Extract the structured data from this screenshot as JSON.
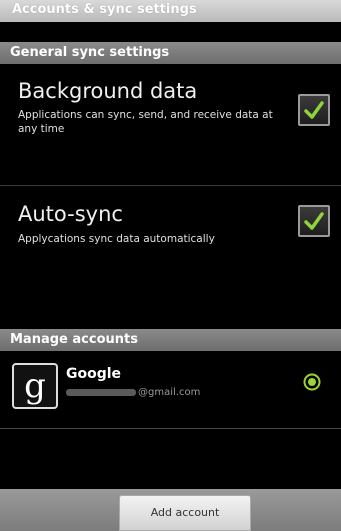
{
  "title_bar": {
    "title": "Accounts & sync settings"
  },
  "general": {
    "header": "General sync settings",
    "background_data": {
      "title": "Background data",
      "summary": "Applications can sync, send, and receive data at any time",
      "checked": true
    },
    "auto_sync": {
      "title": "Auto-sync",
      "summary": "Applycations sync data automatically",
      "checked": true
    }
  },
  "manage": {
    "header": "Manage accounts",
    "account": {
      "logo_letter": "g",
      "name": "Google",
      "email": "@gmail.com",
      "icon": "sync-status-icon"
    }
  },
  "bottom_bar": {
    "add_account_label": "Add account"
  },
  "colors": {
    "check_green": "#8fd43a",
    "sync_green": "#9ad33a"
  }
}
